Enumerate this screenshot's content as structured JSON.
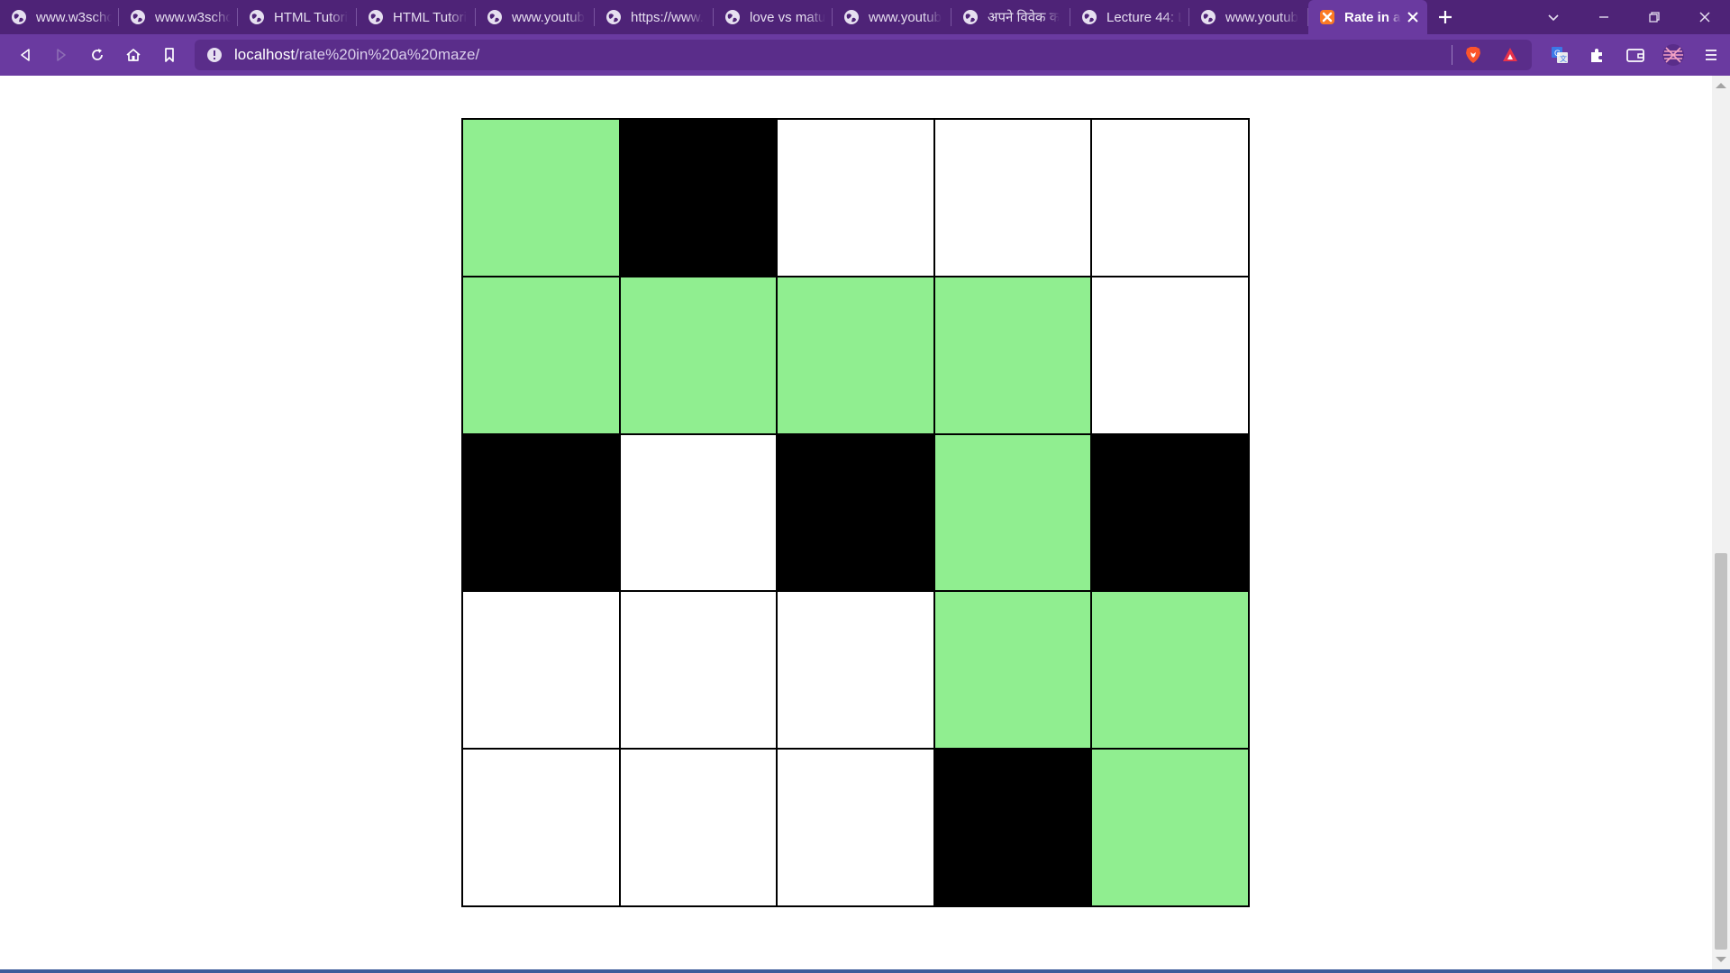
{
  "browser": {
    "tabs": [
      {
        "title": "www.w3scho",
        "icon": "globe-icon"
      },
      {
        "title": "www.w3scho",
        "icon": "globe-icon"
      },
      {
        "title": "HTML Tutori",
        "icon": "globe-icon"
      },
      {
        "title": "HTML Tutori",
        "icon": "globe-icon"
      },
      {
        "title": "www.youtub",
        "icon": "globe-icon"
      },
      {
        "title": "https://www.",
        "icon": "globe-icon"
      },
      {
        "title": "love vs matu",
        "icon": "globe-icon"
      },
      {
        "title": "www.youtub",
        "icon": "globe-icon"
      },
      {
        "title": "अपने विवेक क",
        "icon": "globe-icon"
      },
      {
        "title": "Lecture 44: L",
        "icon": "globe-icon"
      },
      {
        "title": "www.youtub",
        "icon": "globe-icon"
      },
      {
        "title": "Rate in a",
        "icon": "xampp-icon",
        "active": true
      }
    ],
    "address": {
      "host": "localhost",
      "path": "/rate%20in%20a%20maze/"
    },
    "colors": {
      "frame": "#4e2377",
      "toolbar": "#6a3aa0"
    }
  },
  "maze": {
    "size": 5,
    "legend": {
      "path": "#90ee90",
      "wall": "#000000",
      "open": "#ffffff"
    },
    "rows": [
      [
        "path",
        "wall",
        "open",
        "open",
        "open"
      ],
      [
        "path",
        "path",
        "path",
        "path",
        "open"
      ],
      [
        "wall",
        "open",
        "wall",
        "path",
        "wall"
      ],
      [
        "open",
        "open",
        "open",
        "path",
        "path"
      ],
      [
        "open",
        "open",
        "open",
        "wall",
        "path"
      ]
    ]
  }
}
